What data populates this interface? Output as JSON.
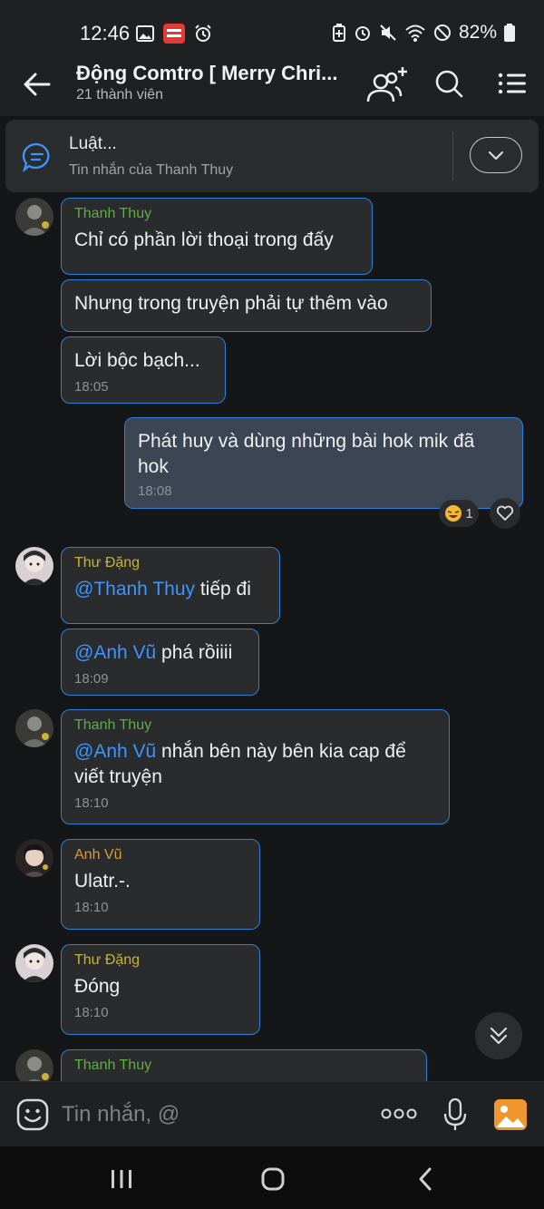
{
  "status": {
    "time": "12:46",
    "battery": "82%"
  },
  "header": {
    "title": "Động Comtro [ Merry Chri...",
    "subtitle": "21 thành viên"
  },
  "pinned": {
    "title": "Luật...",
    "subtitle": "Tin nhắn của Thanh Thuy"
  },
  "messages": {
    "m1": {
      "sender": "Thanh Thuy",
      "text": "Chỉ có phần lời thoại trong đấy"
    },
    "m2": {
      "text": "Nhưng trong truyện phải tự thêm vào"
    },
    "m3": {
      "text": "Lời bộc bạch...",
      "time": "18:05"
    },
    "m4": {
      "text": "Phát huy và dùng những bài hok mik đã hok",
      "time": "18:08",
      "reaction_count": "1"
    },
    "m5": {
      "sender": "Thư Đặng",
      "mention": "@Thanh Thuy",
      "text": " tiếp đi"
    },
    "m6": {
      "mention": "@Anh Vũ",
      "text": " phá rồiiii",
      "time": "18:09"
    },
    "m7": {
      "sender": "Thanh Thuy",
      "mention": "@Anh Vũ",
      "text": " nhắn bên này bên kia cap để viết truyện",
      "time": "18:10"
    },
    "m8": {
      "sender": "Anh Vũ",
      "text": "Ulatr.-.",
      "time": "18:10"
    },
    "m9": {
      "sender": "Thư Đặng",
      "text": "Đóng",
      "time": "18:10"
    },
    "m10": {
      "sender": "Thanh Thuy"
    }
  },
  "composer": {
    "placeholder": "Tin nhắn, @"
  },
  "colors": {
    "accent": "#2f7fd8",
    "mention": "#3d95ff",
    "sender_thanh_thuy": "#5fae45",
    "sender_thu_dang": "#c9b23c",
    "sender_anh_vu": "#d89a3a",
    "background": "#151617"
  }
}
